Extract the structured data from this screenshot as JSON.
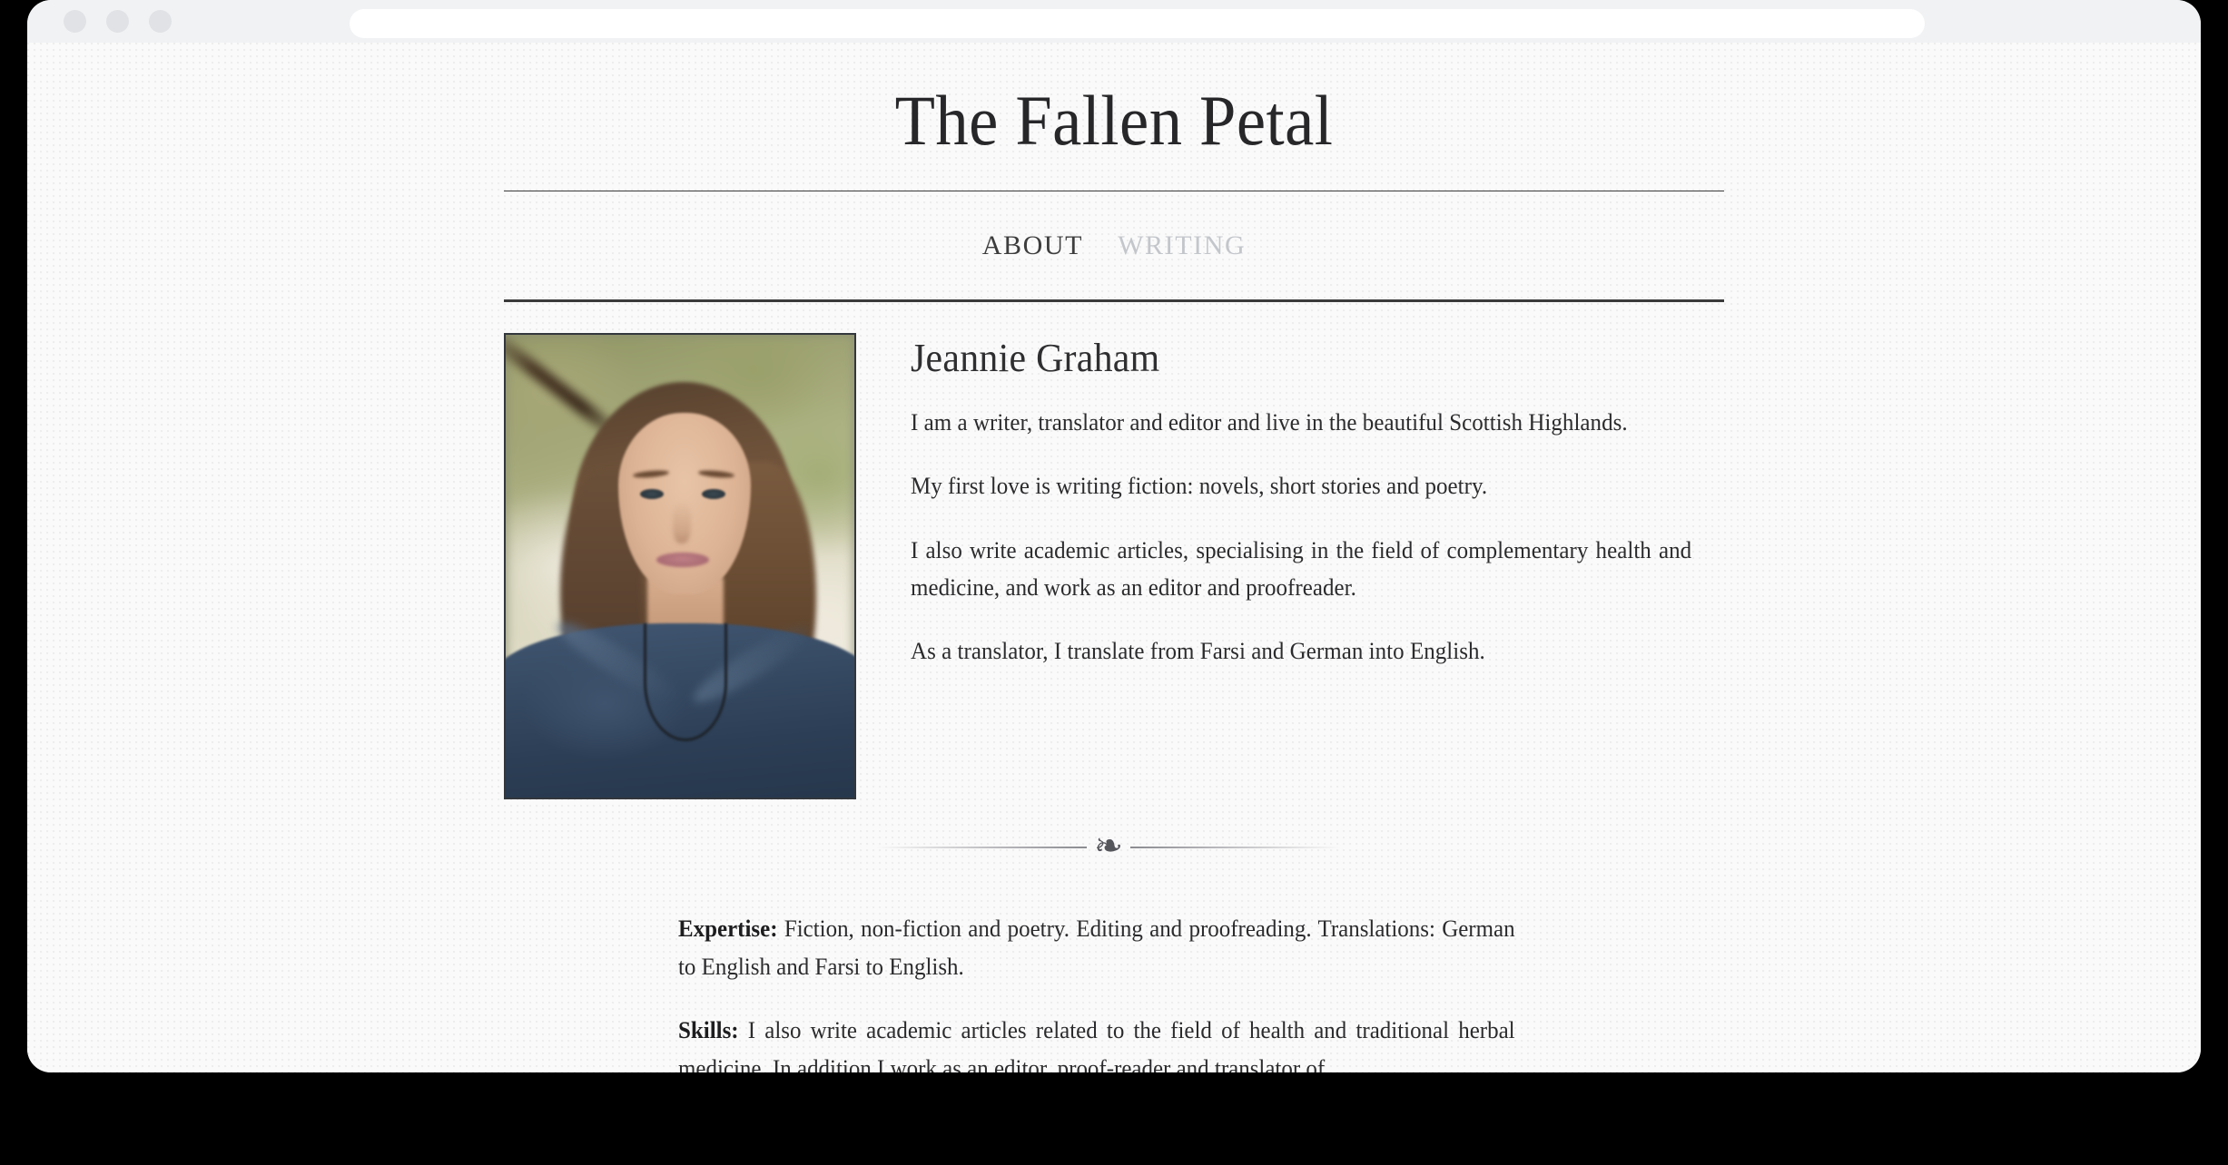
{
  "browser": {
    "traffic_lights": [
      "close",
      "minimize",
      "maximize"
    ],
    "address_bar_value": "",
    "address_bar_placeholder": ""
  },
  "site": {
    "title": "The Fallen Petal"
  },
  "nav": {
    "items": [
      {
        "label": "ABOUT",
        "active": true
      },
      {
        "label": "WRITING",
        "active": false
      }
    ]
  },
  "bio": {
    "portrait_alt": "Portrait of Jeannie Graham outdoors",
    "name": "Jeannie Graham",
    "paragraphs": [
      "I am a writer, translator and editor and live in the beautiful Scottish Highlands.",
      "My first love is writing fiction: novels, short stories and poetry.",
      "I also write academic articles, specialising in the field of complementary health and medicine, and work as an editor and proofreader.",
      "As a translator, I translate from Farsi and German into English."
    ]
  },
  "divider": {
    "ornament": "❧"
  },
  "details": {
    "expertise_label": "Expertise:",
    "expertise_text": " Fiction, non-fiction and poetry. Editing and proofreading. Translations: German to English and Farsi to English.",
    "skills_label": "Skills:",
    "skills_text": " I also write academic articles related to the field of health and traditional herbal medicine. In addition I work as an editor, proof-reader and translator of"
  },
  "colors": {
    "page_background": "#fafafa",
    "chrome_background": "#f1f2f4",
    "text": "#2b2b2d",
    "title": "#27272a",
    "nav_active": "#3d3d3d",
    "nav_inactive": "#c3c6cb",
    "rule": "#3b3b3b",
    "outer_background": "#000000"
  }
}
